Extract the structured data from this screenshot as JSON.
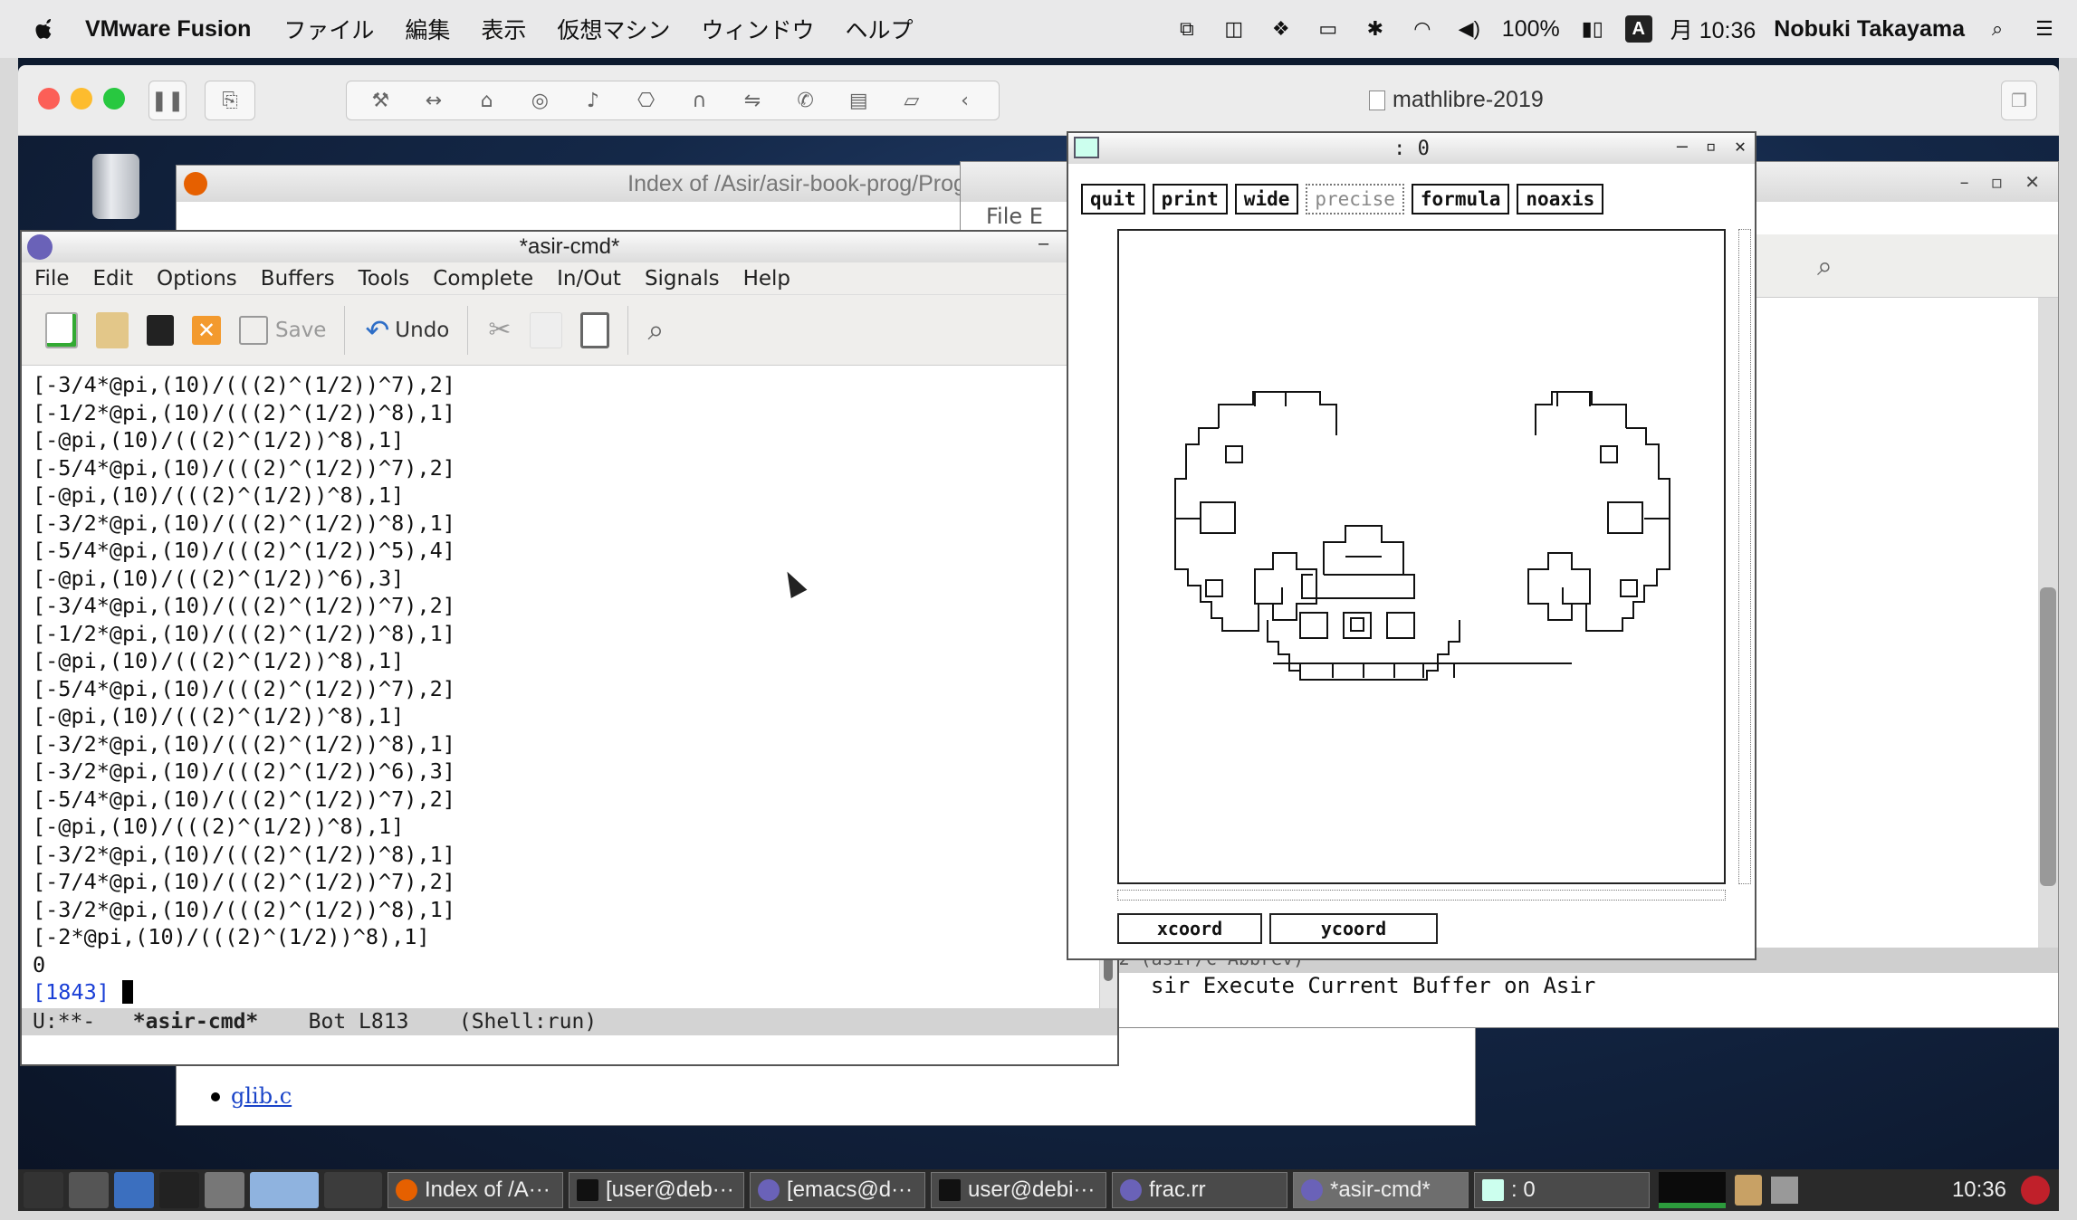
{
  "mac_menubar": {
    "app_name": "VMware Fusion",
    "menus": [
      "ファイル",
      "編集",
      "表示",
      "仮想マシン",
      "ウィンドウ",
      "ヘルプ"
    ],
    "battery": "100%",
    "input_mode": "A",
    "clock": "月 10:36",
    "user": "Nobuki Takayama"
  },
  "vmware": {
    "vm_name": "mathlibre-2019"
  },
  "firefox_window": {
    "title": "Index of /Asir/asir-book-prog/Prog - Mo:",
    "link": "glib.c"
  },
  "bg_emacs": {
    "menu_fragment": "File  E",
    "modeline_fragment": "-:---  99% L32   (asir/C Abbrev)",
    "minibuffer": "sir Execute Current Buffer on Asir"
  },
  "emacs": {
    "title": "*asir-cmd*",
    "menus": [
      "File",
      "Edit",
      "Options",
      "Buffers",
      "Tools",
      "Complete",
      "In/Out",
      "Signals",
      "Help"
    ],
    "toolbar": {
      "save_label": "Save",
      "undo_label": "Undo"
    },
    "lines": [
      "[-3/4*@pi,(10)/(((2)^(1/2))^7),2]",
      "[-1/2*@pi,(10)/(((2)^(1/2))^8),1]",
      "[-@pi,(10)/(((2)^(1/2))^8),1]",
      "[-5/4*@pi,(10)/(((2)^(1/2))^7),2]",
      "[-@pi,(10)/(((2)^(1/2))^8),1]",
      "[-3/2*@pi,(10)/(((2)^(1/2))^8),1]",
      "[-5/4*@pi,(10)/(((2)^(1/2))^5),4]",
      "[-@pi,(10)/(((2)^(1/2))^6),3]",
      "[-3/4*@pi,(10)/(((2)^(1/2))^7),2]",
      "[-1/2*@pi,(10)/(((2)^(1/2))^8),1]",
      "[-@pi,(10)/(((2)^(1/2))^8),1]",
      "[-5/4*@pi,(10)/(((2)^(1/2))^7),2]",
      "[-@pi,(10)/(((2)^(1/2))^8),1]",
      "[-3/2*@pi,(10)/(((2)^(1/2))^8),1]",
      "[-3/2*@pi,(10)/(((2)^(1/2))^6),3]",
      "[-5/4*@pi,(10)/(((2)^(1/2))^7),2]",
      "[-@pi,(10)/(((2)^(1/2))^8),1]",
      "[-3/2*@pi,(10)/(((2)^(1/2))^8),1]",
      "[-7/4*@pi,(10)/(((2)^(1/2))^7),2]",
      "[-3/2*@pi,(10)/(((2)^(1/2))^8),1]",
      "[-2*@pi,(10)/(((2)^(1/2))^8),1]",
      "0"
    ],
    "prompt": "[1843]",
    "modeline": {
      "status": "U:**-",
      "buffer": "*asir-cmd*",
      "position": "Bot L813",
      "mode": "(Shell:run)"
    }
  },
  "plot": {
    "title": ": 0",
    "buttons": {
      "quit": "quit",
      "print": "print",
      "wide": "wide",
      "precise": "precise",
      "formula": "formula",
      "noaxis": "noaxis"
    },
    "xcoord": "xcoord",
    "ycoord": "ycoord"
  },
  "taskbar": {
    "tasks": [
      "Index of /A···",
      "[user@deb···",
      "[emacs@d···",
      "user@debi···",
      "frac.rr",
      "*asir-cmd*",
      ": 0"
    ],
    "clock": "10:36"
  }
}
